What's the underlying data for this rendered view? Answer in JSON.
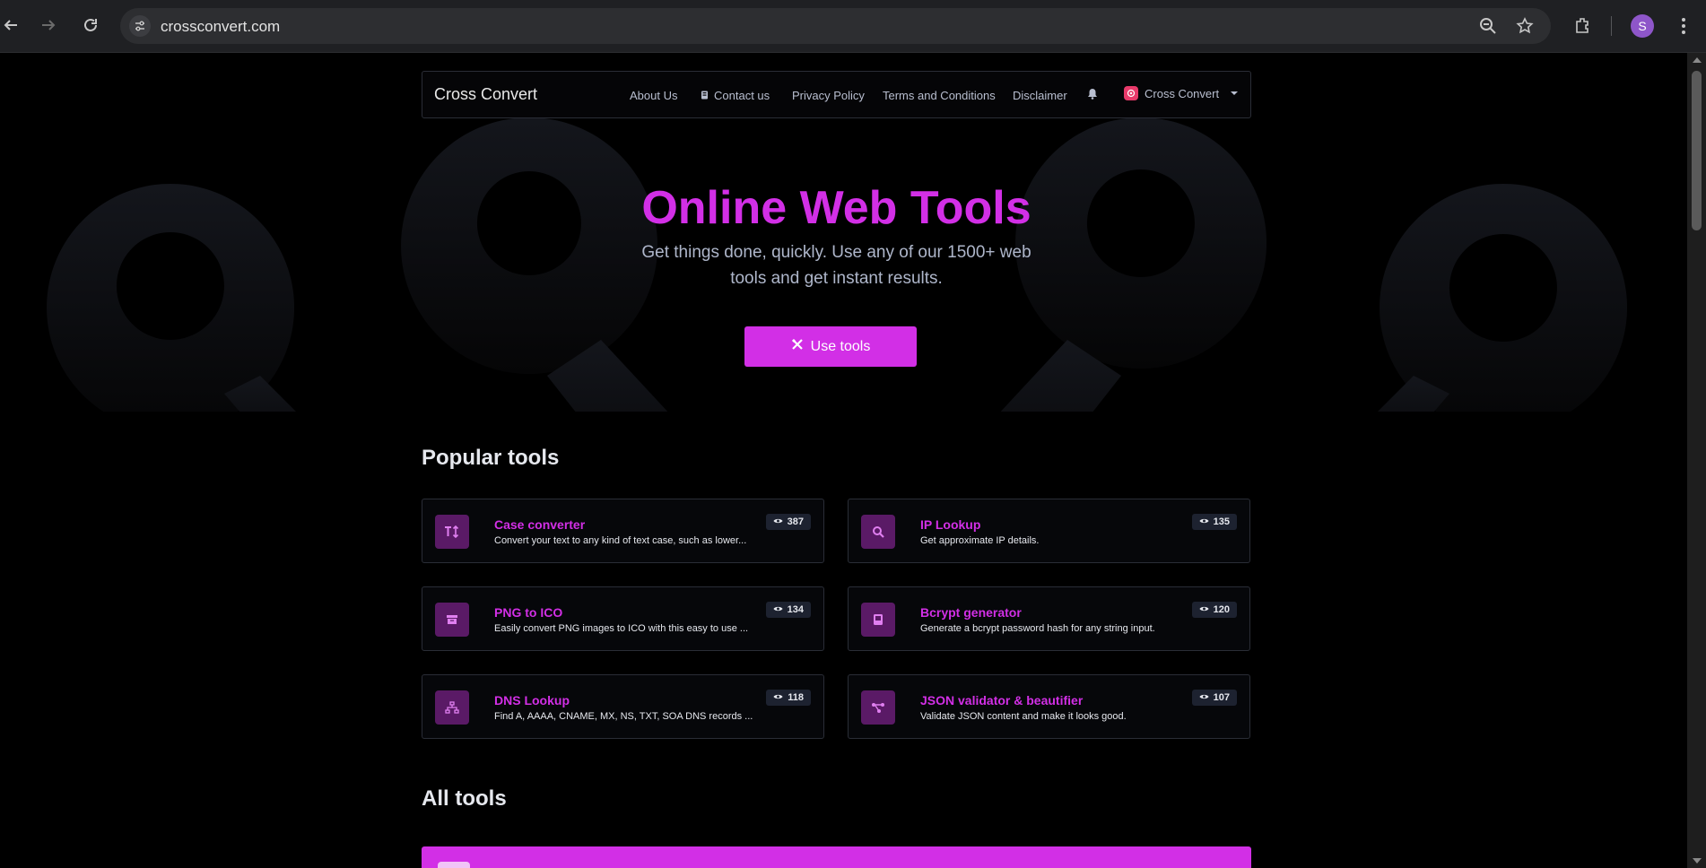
{
  "browser": {
    "url": "crossconvert.com",
    "profile_initial": "S"
  },
  "site": {
    "brand": "Cross Convert",
    "nav": {
      "about": "About Us",
      "contact": "Contact us",
      "privacy": "Privacy Policy",
      "terms": "Terms and Conditions",
      "disclaimer": "Disclaimer",
      "profile": "Cross Convert"
    }
  },
  "hero": {
    "title": "Online Web Tools",
    "subtitle": "Get things done, quickly. Use any of our 1500+ web tools and get instant results.",
    "cta": "Use tools"
  },
  "popular": {
    "heading": "Popular tools",
    "tools": [
      {
        "title": "Case converter",
        "desc": "Convert your text to any kind of text case, such as lower...",
        "views": "387",
        "icon": "text-case-icon"
      },
      {
        "title": "IP Lookup",
        "desc": "Get approximate IP details.",
        "views": "135",
        "icon": "magnifier-icon"
      },
      {
        "title": "PNG to ICO",
        "desc": "Easily convert PNG images to ICO with this easy to use ...",
        "views": "134",
        "icon": "archive-icon"
      },
      {
        "title": "Bcrypt generator",
        "desc": "Generate a bcrypt password hash for any string input.",
        "views": "120",
        "icon": "book-icon"
      },
      {
        "title": "DNS Lookup",
        "desc": "Find A, AAAA, CNAME, MX, NS, TXT, SOA DNS records ...",
        "views": "118",
        "icon": "network-icon"
      },
      {
        "title": "JSON validator & beautifier",
        "desc": "Validate JSON content and make it looks good.",
        "views": "107",
        "icon": "branch-icon"
      }
    ]
  },
  "all": {
    "heading": "All tools"
  },
  "colors": {
    "accent": "#d22fe6",
    "background": "#000000",
    "card_border": "#2a2d36"
  }
}
